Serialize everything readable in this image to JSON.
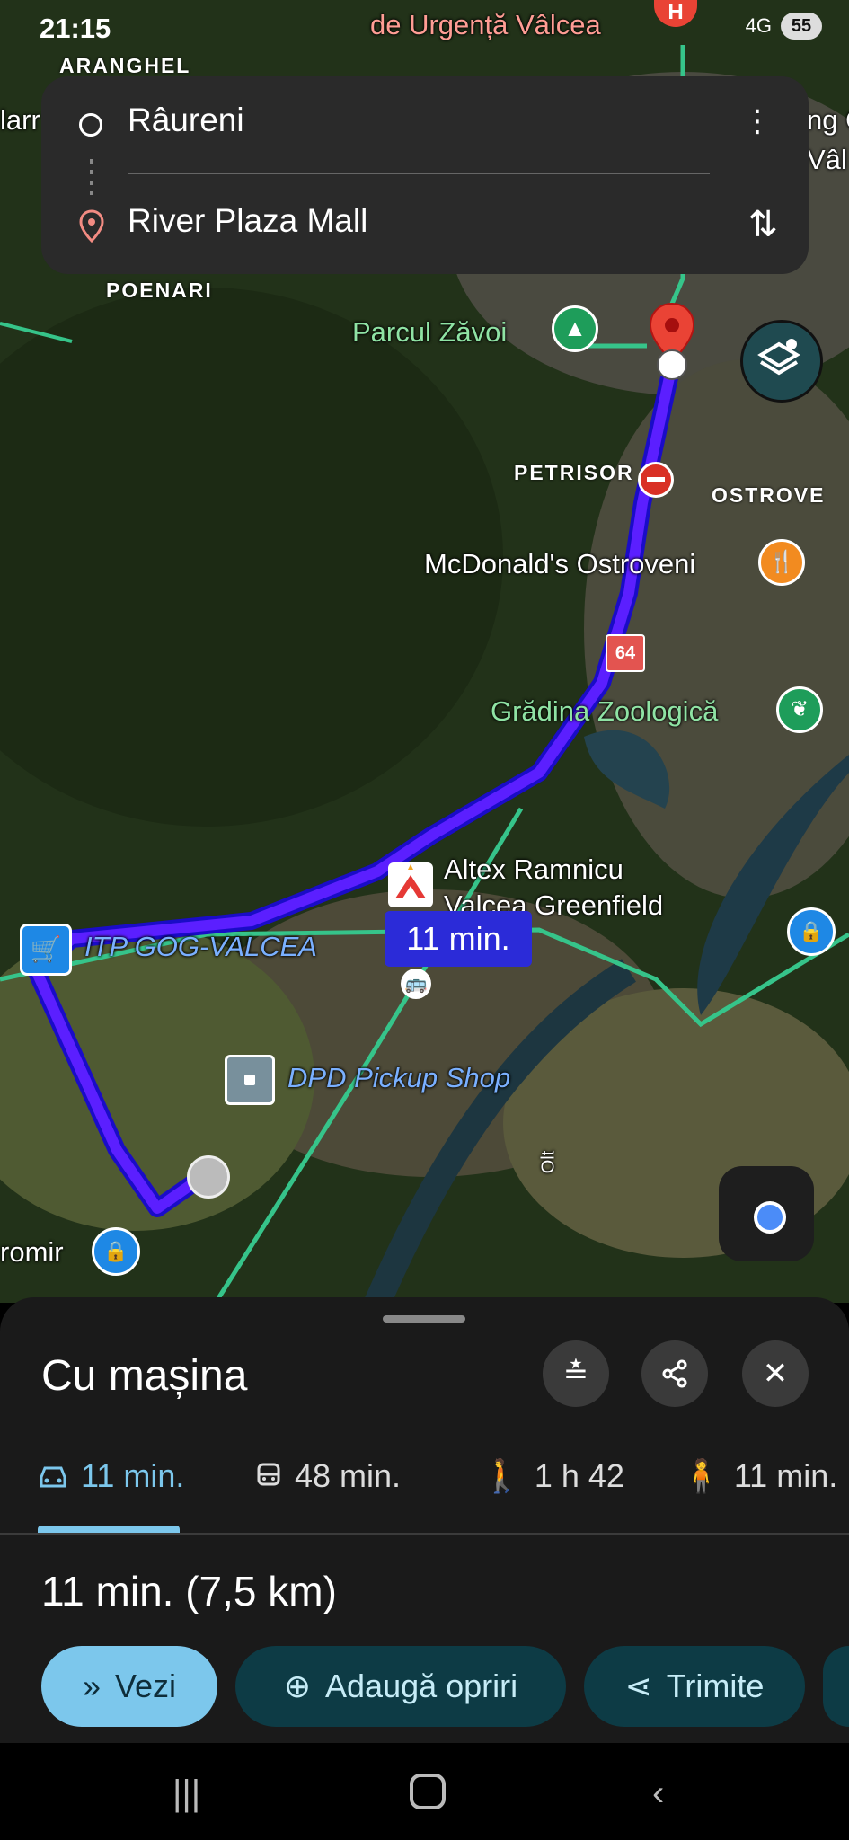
{
  "status_bar": {
    "time": "21:15",
    "battery": "55",
    "network": "4G"
  },
  "search": {
    "origin": "Râureni",
    "destination": "River Plaza Mall"
  },
  "map": {
    "area_labels": [
      "ARANGHEL",
      "POENARI",
      "PETRISOR",
      "OSTROVE"
    ],
    "top_label": "de Urgență Vâlcea",
    "edge_labels": {
      "left": "larr",
      "right_top": "ng O",
      "right_mid": "Vâl",
      "bottom_left": "romir"
    },
    "pois": {
      "parcul": "Parcul Zăvoi",
      "mcdonalds": "McDonald's Ostroveni",
      "zoo": "Grădina Zoologică",
      "altex_line1": "Altex Ramnicu",
      "altex_line2": "Valcea Greenfield",
      "itp": "ITP GOG-VALCEA",
      "dpd": "DPD Pickup Shop",
      "olt": "Olt",
      "road": "64"
    },
    "eta_badge": "11 min."
  },
  "sheet": {
    "mode_title": "Cu mașina",
    "tabs": [
      {
        "icon": "car-icon",
        "label": "11 min.",
        "active": true
      },
      {
        "icon": "train-icon",
        "label": "48 min.",
        "active": false
      },
      {
        "icon": "walk-icon",
        "label": "1 h 42",
        "active": false
      },
      {
        "icon": "ride-icon",
        "label": "11 min.",
        "active": false
      }
    ],
    "summary": "11 min. (7,5 km)",
    "actions": {
      "view": "Vezi",
      "add_stops": "Adaugă opriri",
      "share": "Trimite"
    }
  },
  "colors": {
    "route": "#5b1fff",
    "accent": "#7cc7ec",
    "pin": "#ea4335",
    "sheet_bg": "#1a1a1a"
  }
}
